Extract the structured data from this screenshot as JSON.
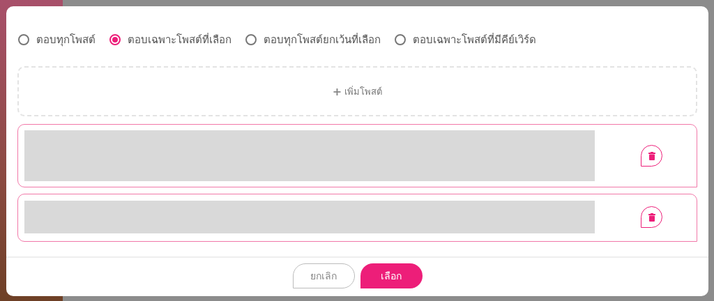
{
  "reply_options": [
    {
      "label": "ตอบทุกโพสต์",
      "selected": false
    },
    {
      "label": "ตอบเฉพาะโพสต์ที่เลือก",
      "selected": true
    },
    {
      "label": "ตอบทุกโพสต์ยกเว้นที่เลือก",
      "selected": false
    },
    {
      "label": "ตอบเฉพาะโพสต์ที่มีคีย์เวิร์ด",
      "selected": false
    }
  ],
  "add_post": {
    "icon": "+",
    "label": "เพิ่มโพสต์"
  },
  "posts": [
    {
      "kind": "tall"
    },
    {
      "kind": "short"
    }
  ],
  "buttons": [
    {
      "label": "ยกเลิก",
      "kind": "secondary"
    },
    {
      "label": "เลือก",
      "kind": "primary"
    }
  ]
}
